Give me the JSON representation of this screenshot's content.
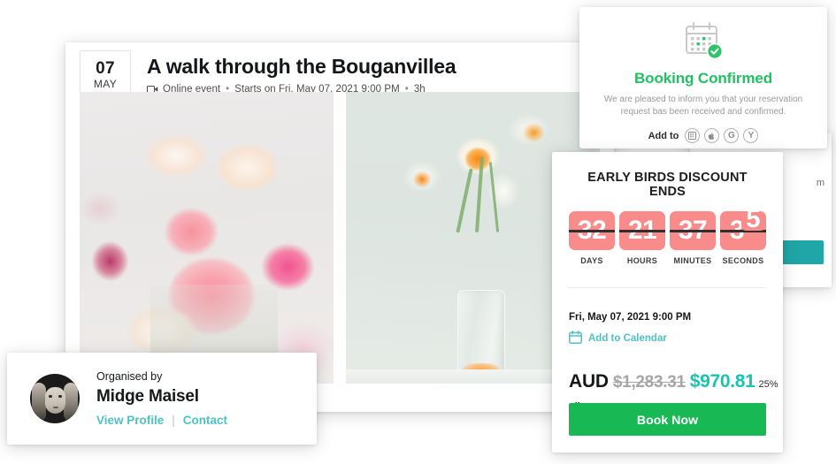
{
  "event": {
    "date_day": "07",
    "date_month": "MAY",
    "title": "A walk through the Bouganvillea",
    "meta_type": "Online event",
    "meta_sep1": "•",
    "meta_start": "Starts on Fri, May 07, 2021 9:00 PM",
    "meta_sep2": "•",
    "meta_duration": "3h",
    "video_icon": "video-camera-icon",
    "photos": [
      {
        "alt": "pink and white roses bouquet in glass vase"
      },
      {
        "alt": "white and orange daffodils in a glass vase"
      }
    ]
  },
  "confirmation": {
    "icon": "calendar-check-icon",
    "title": "Booking Confirmed",
    "message": "We are pleased to inform you that your reservation request bas been received and confirmed.",
    "add_to_label": "Add to",
    "providers": [
      {
        "name": "outlook-icon",
        "glyph": "▦"
      },
      {
        "name": "apple-icon",
        "glyph": ""
      },
      {
        "name": "google-icon",
        "glyph": "G"
      },
      {
        "name": "yahoo-icon",
        "glyph": "Y"
      }
    ]
  },
  "booking": {
    "countdown_title": "EARLY BIRDS DISCOUNT ENDS",
    "countdown": [
      {
        "value": "32",
        "label": "DAYS",
        "flipping": false
      },
      {
        "value": "21",
        "label": "HOURS",
        "flipping": false
      },
      {
        "value": "37",
        "label": "MINUTES",
        "flipping": false
      },
      {
        "value": "3",
        "label": "SECONDS",
        "flipping": true,
        "flip_digit": "5"
      }
    ],
    "when": "Fri, May 07, 2021 9:00 PM",
    "add_to_calendar": "Add to Calendar",
    "add_to_calendar_icon": "calendar-icon",
    "currency": "AUD",
    "old_price": "$1,283.31",
    "new_price": "$970.81",
    "discount_pct": "25%",
    "discount_off": "off",
    "book_button": "Book Now"
  },
  "organiser": {
    "avatar_name": "organiser-avatar",
    "label": "Organised by",
    "name": "Midge Maisel",
    "view_profile": "View Profile",
    "separator": "|",
    "contact": "Contact"
  },
  "colors": {
    "confirm_green": "#23bf63",
    "book_green": "#18b955",
    "teal_link": "#4ec2c2",
    "price_teal": "#1ac3b0",
    "flip_salmon": "#f98b8b",
    "behind_teal": "#1fa6a6"
  }
}
